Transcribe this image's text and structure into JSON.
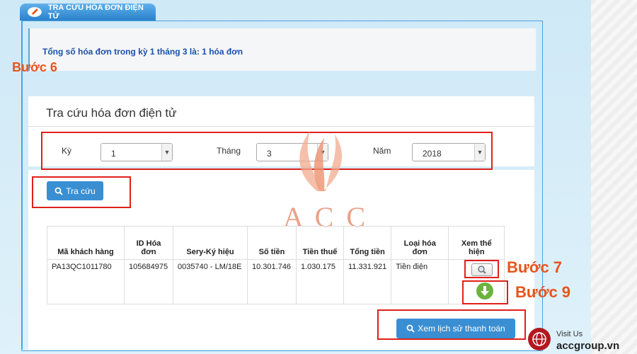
{
  "header": {
    "tab_title": "TRA CỨU HÓA ĐƠN ĐIỆN TỬ"
  },
  "summary": {
    "text": "Tổng số hóa đơn trong kỳ 1 tháng 3 là: 1 hóa đơn"
  },
  "steps": {
    "step6": "Bước 6",
    "step7": "Bước 7",
    "step9": "Bước 9"
  },
  "search_panel": {
    "title": "Tra cứu hóa đơn điện tử",
    "ky_label": "Kỳ",
    "ky_value": "1",
    "thang_label": "Tháng",
    "thang_value": "3",
    "nam_label": "Năm",
    "nam_value": "2018",
    "search_button": "Tra cứu"
  },
  "table": {
    "headers": [
      "Mã khách hàng",
      "ID Hóa đơn",
      "Sery-Ký hiệu",
      "Số tiền",
      "Tiền thuế",
      "Tổng tiền",
      "Loại hóa đơn",
      "Xem thể hiện"
    ],
    "rows": [
      [
        "PA13QC1011780",
        "105684975",
        "0035740 - LM/18E",
        "10.301.746",
        "1.030.175",
        "11.331.921",
        "Tiền điện",
        ""
      ]
    ]
  },
  "history_button": "Xem lịch sử thanh toán",
  "watermark": {
    "text": "A C C"
  },
  "footer": {
    "visit": "Visit Us",
    "site": "accgroup.vn"
  },
  "colors": {
    "accent": "#3a8fd3",
    "step": "#e8541c",
    "highlight": "#e0201b",
    "title_blue": "#1c4fae"
  }
}
